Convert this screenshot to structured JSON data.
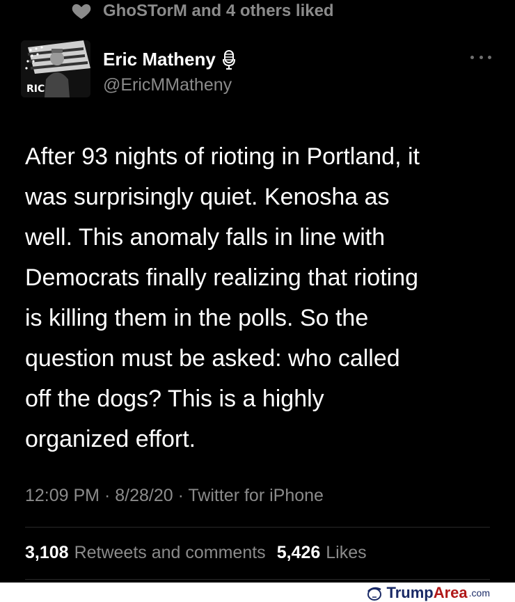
{
  "social_context": {
    "icon": "heart-icon",
    "text": "GhoSTorM and 4 others liked"
  },
  "author": {
    "display_name": "Eric Matheny",
    "handle": "@EricMMatheny",
    "badge_icon": "microphone-icon",
    "avatar_label": "RIC"
  },
  "tweet": {
    "lines": [
      "After 93 nights of rioting in Portland, it",
      "was surprisingly quiet. Kenosha as",
      "well. This anomaly falls in line with",
      "Democrats finally realizing that rioting",
      "is killing them in the polls. So the",
      "question must be asked: who called",
      "off the dogs? This is a highly",
      "organized effort."
    ],
    "timestamp": "12:09 PM · 8/28/20 · Twitter for iPhone"
  },
  "stats": {
    "retweets_count": "3,108",
    "retweets_label": "Retweets and comments",
    "likes_count": "5,426",
    "likes_label": "Likes"
  },
  "watermark": {
    "part1": "Trump",
    "part2": "Area",
    "part3": ".com"
  },
  "colors": {
    "background": "#000000",
    "primary_text": "#ffffff",
    "secondary_text": "#8b8b8b"
  }
}
